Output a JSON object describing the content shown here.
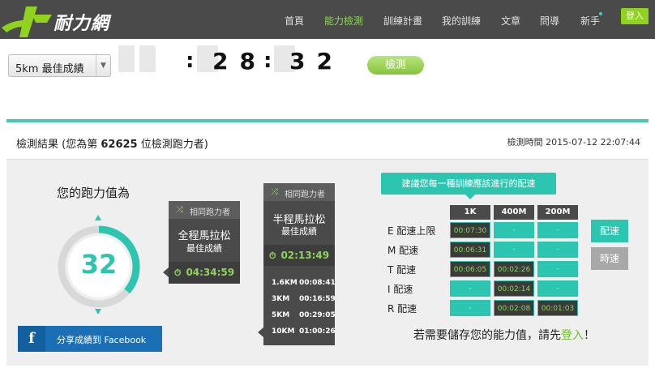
{
  "brand": {
    "name": "耐力網"
  },
  "nav": {
    "items": [
      "首頁",
      "能力檢測",
      "訓練計畫",
      "我的訓練",
      "文章",
      "問導",
      "新手"
    ],
    "login": "登入"
  },
  "input": {
    "distance": "5km 最佳成績",
    "minutes": "28",
    "seconds": "32",
    "check_label": "檢測"
  },
  "result": {
    "title_prefix": "檢測結果 (您為第",
    "rank": "62625",
    "title_suffix": "位檢測跑力者)",
    "time_label": "檢測時間",
    "time_value": "2015-07-12 22:07:44",
    "score_label": "您的跑力值為",
    "score": "32",
    "facebook_label": "分享成績到 Facebook"
  },
  "marathon": {
    "head": "相同跑力者",
    "title": "全程馬拉松",
    "sub": "最佳成績",
    "time": "04:34:59"
  },
  "half": {
    "head": "相同跑力者",
    "title": "半程馬拉松",
    "sub": "最佳成績",
    "time": "02:13:49",
    "splits": [
      {
        "dist": "1.6KM",
        "time": "00:08:41"
      },
      {
        "dist": "3KM",
        "time": "00:16:59"
      },
      {
        "dist": "5KM",
        "time": "00:29:05"
      },
      {
        "dist": "10KM",
        "time": "01:00:26"
      }
    ]
  },
  "pace": {
    "tip": "建議您每一種訓練應該進行的配速",
    "columns": [
      "1K",
      "400M",
      "200M"
    ],
    "rows": [
      {
        "label": "E 配速上限",
        "values": [
          "00:07:30",
          "-",
          "-"
        ]
      },
      {
        "label": "M 配速",
        "values": [
          "00:06:31",
          "-",
          "-"
        ]
      },
      {
        "label": "T 配速",
        "values": [
          "00:06:05",
          "00:02:26",
          "-"
        ]
      },
      {
        "label": "I 配速",
        "values": [
          "-",
          "00:02:14",
          "-"
        ]
      },
      {
        "label": "R 配速",
        "values": [
          "-",
          "00:02:08",
          "00:01:03"
        ]
      }
    ],
    "btn_pace": "配速",
    "btn_time": "時速",
    "save_prefix": "若需要儲存您的能力值，請先",
    "save_link": "登入",
    "save_suffix": "！"
  },
  "colors": {
    "accent": "#2cc6b0",
    "green": "#8fd35c",
    "dark": "#4a4a4a"
  }
}
